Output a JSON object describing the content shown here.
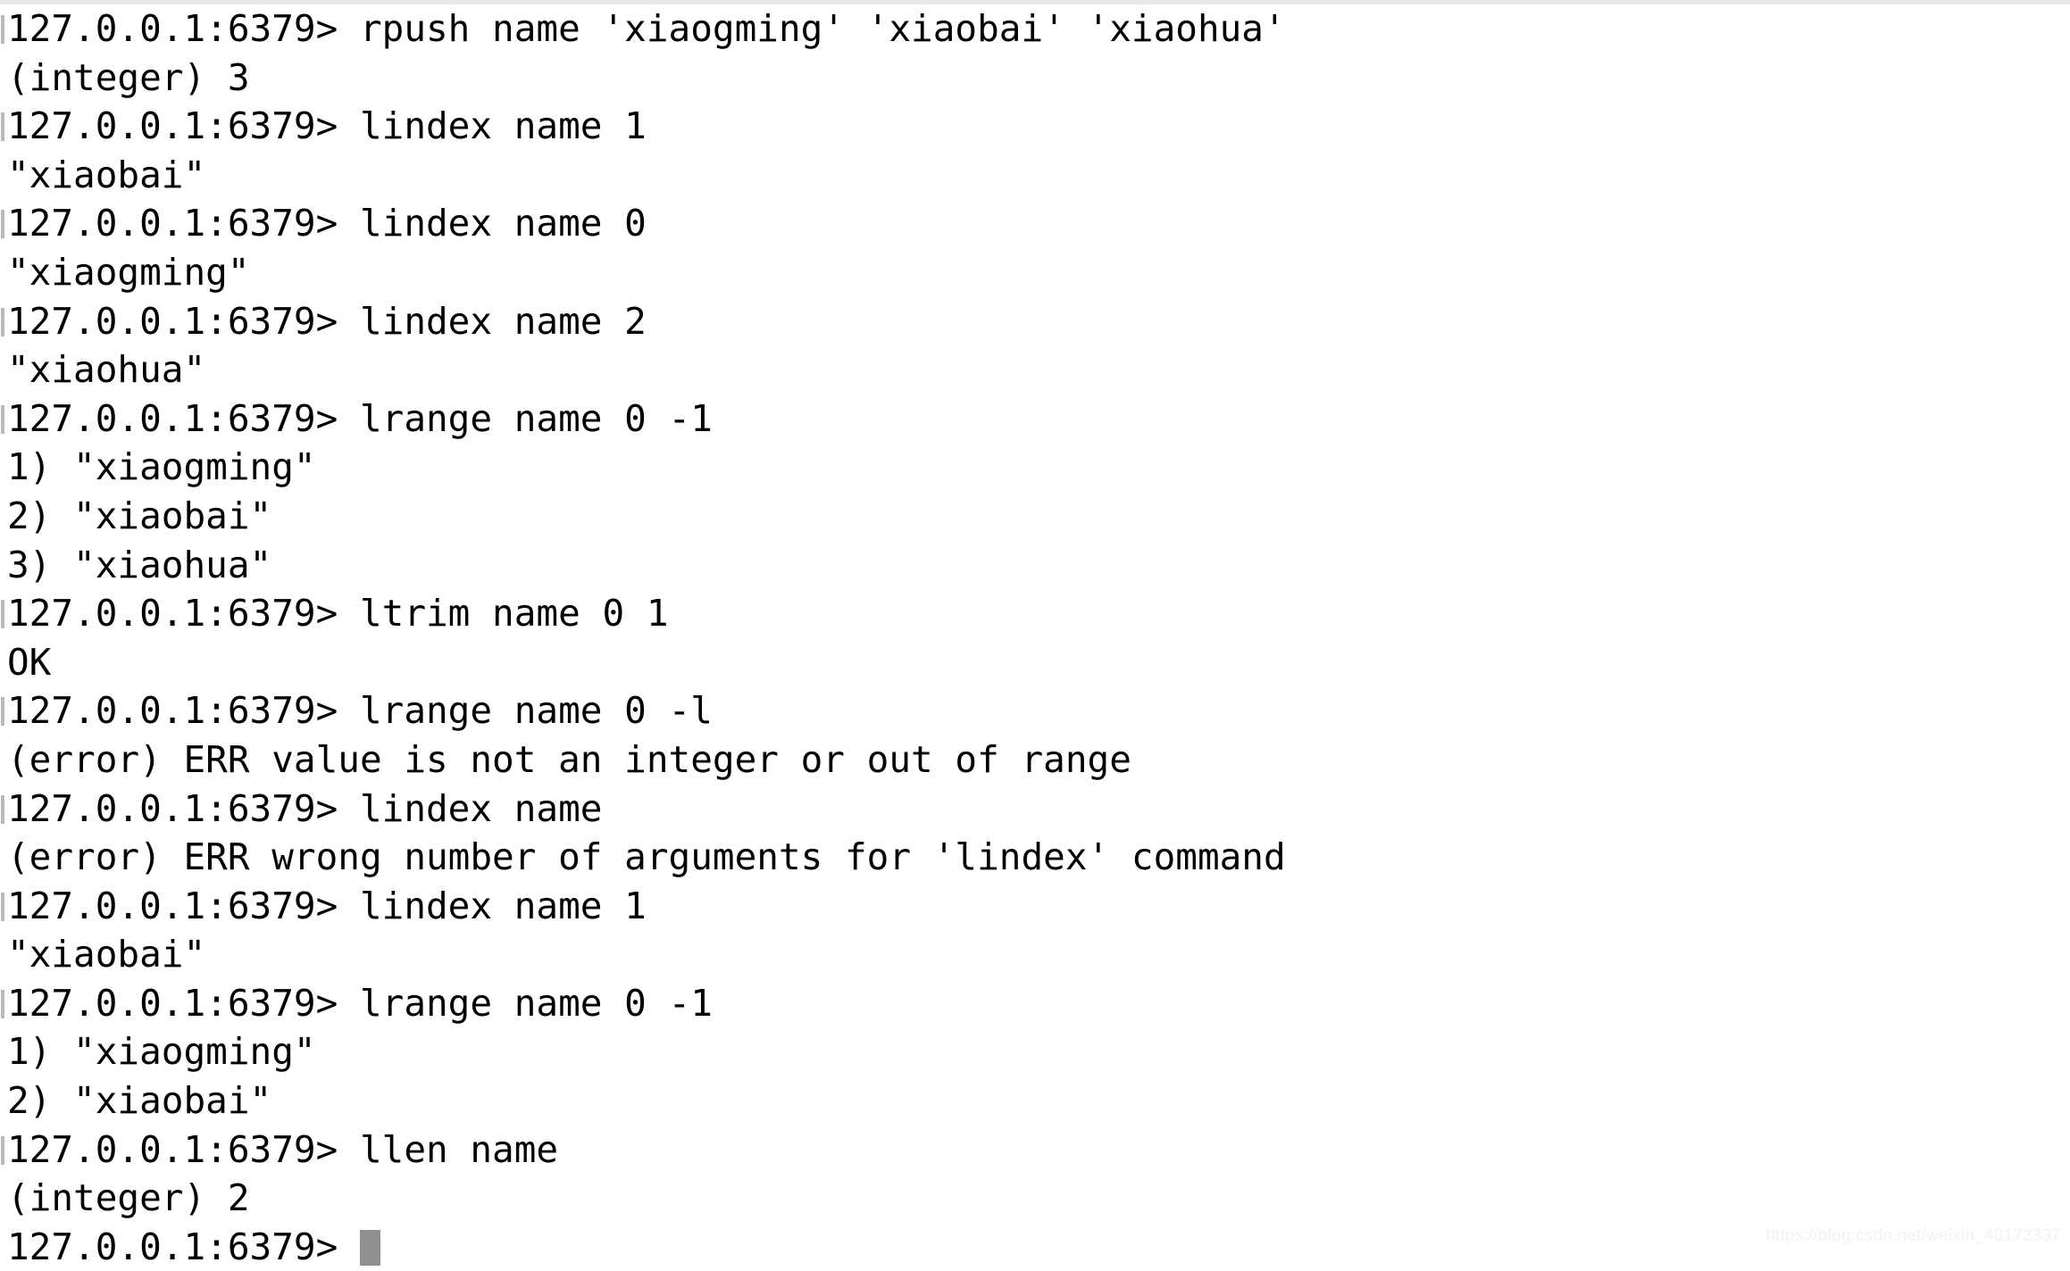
{
  "terminal": {
    "app": "redis-cli",
    "prompt": "127.0.0.1:6379>",
    "background_color": "#ffffff",
    "text_color": "#000000",
    "cursor_color": "#909090",
    "cursor_char": " ",
    "lines": [
      {
        "id": "l01",
        "kind": "prompt",
        "text": "127.0.0.1:6379> rpush name 'xiaogming' 'xiaobai' 'xiaohua'"
      },
      {
        "id": "l02",
        "kind": "output",
        "text": "(integer) 3"
      },
      {
        "id": "l03",
        "kind": "prompt",
        "text": "127.0.0.1:6379> lindex name 1"
      },
      {
        "id": "l04",
        "kind": "output",
        "text": "\"xiaobai\""
      },
      {
        "id": "l05",
        "kind": "prompt",
        "text": "127.0.0.1:6379> lindex name 0"
      },
      {
        "id": "l06",
        "kind": "output",
        "text": "\"xiaogming\""
      },
      {
        "id": "l07",
        "kind": "prompt",
        "text": "127.0.0.1:6379> lindex name 2"
      },
      {
        "id": "l08",
        "kind": "output",
        "text": "\"xiaohua\""
      },
      {
        "id": "l09",
        "kind": "prompt",
        "text": "127.0.0.1:6379> lrange name 0 -1"
      },
      {
        "id": "l10",
        "kind": "output",
        "text": "1) \"xiaogming\""
      },
      {
        "id": "l11",
        "kind": "output",
        "text": "2) \"xiaobai\""
      },
      {
        "id": "l12",
        "kind": "output",
        "text": "3) \"xiaohua\""
      },
      {
        "id": "l13",
        "kind": "prompt",
        "text": "127.0.0.1:6379> ltrim name 0 1"
      },
      {
        "id": "l14",
        "kind": "output",
        "text": "OK"
      },
      {
        "id": "l15",
        "kind": "prompt",
        "text": "127.0.0.1:6379> lrange name 0 -l"
      },
      {
        "id": "l16",
        "kind": "error",
        "text": "(error) ERR value is not an integer or out of range"
      },
      {
        "id": "l17",
        "kind": "prompt",
        "text": "127.0.0.1:6379> lindex name"
      },
      {
        "id": "l18",
        "kind": "error",
        "text": "(error) ERR wrong number of arguments for 'lindex' command"
      },
      {
        "id": "l19",
        "kind": "prompt",
        "text": "127.0.0.1:6379> lindex name 1"
      },
      {
        "id": "l20",
        "kind": "output",
        "text": "\"xiaobai\""
      },
      {
        "id": "l21",
        "kind": "prompt",
        "text": "127.0.0.1:6379> lrange name 0 -1"
      },
      {
        "id": "l22",
        "kind": "output",
        "text": "1) \"xiaogming\""
      },
      {
        "id": "l23",
        "kind": "output",
        "text": "2) \"xiaobai\""
      },
      {
        "id": "l24",
        "kind": "prompt",
        "text": "127.0.0.1:6379> llen name"
      },
      {
        "id": "l25",
        "kind": "output",
        "text": "(integer) 2"
      },
      {
        "id": "l26",
        "kind": "current",
        "text": "127.0.0.1:6379> "
      }
    ]
  },
  "watermark": {
    "text": "https://blog.csdn.net/weixin_40172337"
  }
}
